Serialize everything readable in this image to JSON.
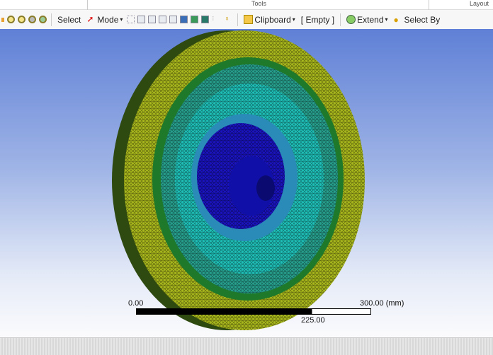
{
  "ribbon": {
    "group_tools": "Tools",
    "group_layout": "Layout"
  },
  "toolbar": {
    "select": "Select",
    "mode": "Mode",
    "clipboard": "Clipboard",
    "empty": "[ Empty ]",
    "extend": "Extend",
    "select_by": "Select By"
  },
  "scale_bar": {
    "start": "0.00",
    "end": "300.00 (mm)",
    "mid": "225.00"
  },
  "colors": {
    "viewport_top": "#5f80d6",
    "mesh_outer": "#b8c41e",
    "mesh_mid": "#2ab4a8",
    "mesh_inner": "#1414b8"
  }
}
